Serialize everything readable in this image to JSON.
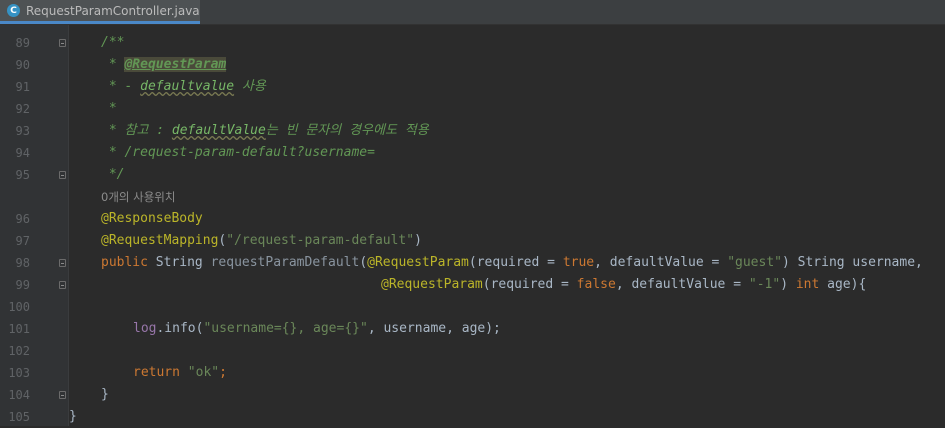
{
  "editor": {
    "tab": {
      "label": "RequestParamController.java",
      "icon": "class-icon",
      "icon_letter": "C"
    },
    "usage_hint": "0개의 사용위치",
    "line_numbers": [
      "89",
      "90",
      "91",
      "92",
      "93",
      "94",
      "95",
      "96",
      "97",
      "98",
      "99",
      "100",
      "101",
      "102",
      "103",
      "104",
      "105"
    ],
    "lines": {
      "l89": "/**",
      "l90_star": " * ",
      "l90_tag": "@RequestParam",
      "l91_star": " * - ",
      "l91_code": "defaultvalue",
      "l91_rest": " 사용",
      "l92_star": " *",
      "l93_star": " * 참고 : ",
      "l93_code": "defaultValue",
      "l93_rest": "는 빈 문자의 경우에도 적용",
      "l94": " * /request-param-default?username=",
      "l95": " */",
      "l96": "@ResponseBody",
      "l97_anno": "@RequestMapping",
      "l97_open": "(",
      "l97_str": "\"/request-param-default\"",
      "l97_close": ")",
      "l98_public": "public",
      "l98_type": " String ",
      "l98_method": "requestParamDefault",
      "l98_paren": "(",
      "l98_anno": "@RequestParam",
      "l98_a1": "(required = ",
      "l98_true": "true",
      "l98_a2": ", defaultValue = ",
      "l98_str": "\"guest\"",
      "l98_a3": ") String username,",
      "l99_anno": "@RequestParam",
      "l99_a1": "(required = ",
      "l99_false": "false",
      "l99_a2": ", defaultValue = ",
      "l99_str": "\"-1\"",
      "l99_a3": ") ",
      "l99_int": "int",
      "l99_a4": " age){",
      "l101_log": "log",
      "l101_a1": ".info(",
      "l101_str": "\"username={}, age={}\"",
      "l101_a2": ", username, age);",
      "l103_return": "return",
      "l103_space": " ",
      "l103_str": "\"ok\"",
      "l103_semi": ";",
      "l104": "}",
      "l105": "}"
    }
  },
  "colors": {
    "background": "#2b2b2b",
    "gutter": "#313335",
    "comment": "#629755",
    "keyword": "#cc7832",
    "annotation": "#bbb529",
    "string": "#6a8759",
    "field": "#9876aa",
    "text": "#a9b7c6"
  }
}
